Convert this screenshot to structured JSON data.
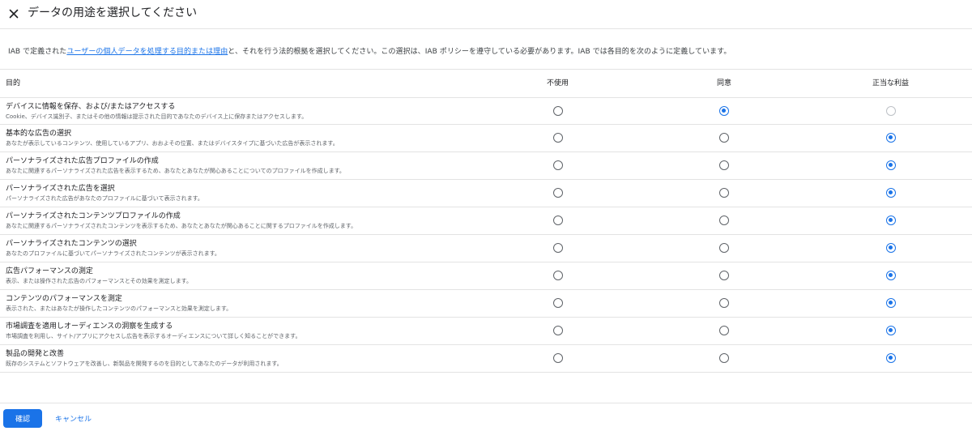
{
  "header": {
    "close_icon": "close-icon",
    "title": "データの用途を選択してください"
  },
  "description": {
    "before": "IAB で定義された",
    "link": "ユーザーの個人データを処理する目的または理由",
    "after": "と、それを行う法的根拠を選択してください。この選択は、IAB ポリシーを遵守している必要があります。IAB では各目的を次のように定義しています。"
  },
  "table": {
    "columns": {
      "purpose": "目的",
      "not_used": "不使用",
      "consent": "同意",
      "legitimate_interest": "正当な利益"
    },
    "rows": [
      {
        "title": "デバイスに情報を保存、および/またはアクセスする",
        "description": "Cookie、デバイス識別子、またはその他の情報は提示された目的であなたのデバイス上に保存またはアクセスします。",
        "selected": "consent",
        "legitimate_interest_disabled": true
      },
      {
        "title": "基本的な広告の選択",
        "description": "あなたが表示しているコンテンツ、使用しているアプリ、おおよその位置、またはデバイスタイプに基づいた広告が表示されます。",
        "selected": "legitimate_interest",
        "legitimate_interest_disabled": false
      },
      {
        "title": "パーソナライズされた広告プロファイルの作成",
        "description": "あなたに関連するパーソナライズされた広告を表示するため、あなたとあなたが関心あることについてのプロファイルを作成します。",
        "selected": "legitimate_interest",
        "legitimate_interest_disabled": false
      },
      {
        "title": "パーソナライズされた広告を選択",
        "description": "パーソナライズされた広告があなたのプロファイルに基づいて表示されます。",
        "selected": "legitimate_interest",
        "legitimate_interest_disabled": false
      },
      {
        "title": "パーソナライズされたコンテンツプロファイルの作成",
        "description": "あなたに関連するパーソナライズされたコンテンツを表示するため、あなたとあなたが関心あることに関するプロファイルを作成します。",
        "selected": "legitimate_interest",
        "legitimate_interest_disabled": false
      },
      {
        "title": "パーソナライズされたコンテンツの選択",
        "description": "あなたのプロファイルに基づいてパーソナライズされたコンテンツが表示されます。",
        "selected": "legitimate_interest",
        "legitimate_interest_disabled": false
      },
      {
        "title": "広告パフォーマンスの測定",
        "description": "表示、または操作された広告のパフォーマンスとその効果を測定します。",
        "selected": "legitimate_interest",
        "legitimate_interest_disabled": false
      },
      {
        "title": "コンテンツのパフォーマンスを測定",
        "description": "表示された、またはあなたが操作したコンテンツのパフォーマンスと効果を測定します。",
        "selected": "legitimate_interest",
        "legitimate_interest_disabled": false
      },
      {
        "title": "市場調査を適用しオーディエンスの洞察を生成する",
        "description": "市場調査を利用し、サイト/アプリにアクセスし広告を表示するオーディエンスについて詳しく知ることができます。",
        "selected": "legitimate_interest",
        "legitimate_interest_disabled": false
      },
      {
        "title": "製品の開発と改善",
        "description": "既存のシステムとソフトウェアを改善し、新製品を開発するのを目的としてあなたのデータが利用されます。",
        "selected": "legitimate_interest",
        "legitimate_interest_disabled": false
      }
    ]
  },
  "footer": {
    "confirm_label": "確認",
    "cancel_label": "キャンセル"
  },
  "colors": {
    "accent": "#1a73e8",
    "divider": "#e3e3e3",
    "secondary_text": "#5f6368"
  }
}
